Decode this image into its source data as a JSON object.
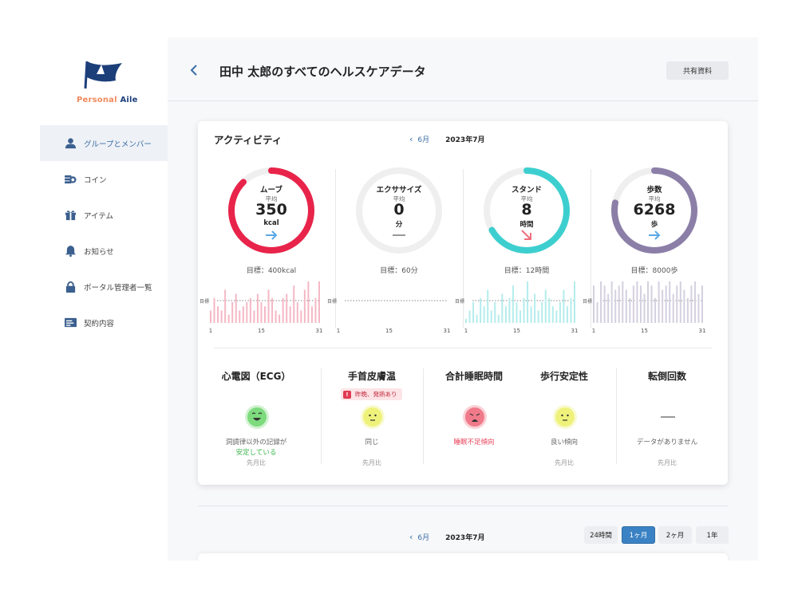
{
  "app": {
    "logo_text_part1": "Personal",
    "logo_text_part2": "Aile"
  },
  "sidebar": {
    "items": [
      {
        "label": "グループとメンバー",
        "icon": "person-icon",
        "active": true
      },
      {
        "label": "コイン",
        "icon": "coin-icon",
        "active": false
      },
      {
        "label": "アイテム",
        "icon": "gift-icon",
        "active": false
      },
      {
        "label": "お知らせ",
        "icon": "bell-icon",
        "active": false
      },
      {
        "label": "ポータル管理者一覧",
        "icon": "lock-icon",
        "active": false
      },
      {
        "label": "契約内容",
        "icon": "contract-icon",
        "active": false
      }
    ]
  },
  "header": {
    "title": "田中 太郎のすべてのヘルスケアデータ",
    "share_label": "共有資料"
  },
  "activity": {
    "title": "アクティビティ",
    "prev_month": "6月",
    "current_month": "2023年7月",
    "metrics": [
      {
        "name": "ムーブ",
        "avg_label": "平均",
        "value": "350",
        "unit": "kcal",
        "goal": "目標：400kcal",
        "trend": "flat",
        "progress": 0.875,
        "color": "#e8244a",
        "bar_color": "#f5b8c4",
        "chart_goal_label": "目標",
        "axis": [
          "1",
          "15",
          "31"
        ],
        "bars": [
          0.3,
          0.6,
          0.4,
          0.3,
          0.8,
          0.2,
          0.5,
          0.7,
          0.3,
          0.4,
          0.5,
          0.6,
          0.3,
          0.7,
          0.5,
          0.4,
          0.8,
          0.6,
          0.3,
          0.2,
          0.6,
          0.7,
          0.4,
          0.9,
          0.5,
          0.3,
          0.8,
          1.0,
          0.4,
          0.6,
          1.0
        ]
      },
      {
        "name": "エクササイズ",
        "avg_label": "平均",
        "value": "0",
        "unit": "分",
        "goal": "目標：60分",
        "trend": "none",
        "progress": 0,
        "color": "#f0f0f0",
        "bar_color": "#e0e0e0",
        "chart_goal_label": "目標",
        "axis": [
          "1",
          "15",
          "31"
        ],
        "bars": []
      },
      {
        "name": "スタンド",
        "avg_label": "平均",
        "value": "8",
        "unit": "時間",
        "goal": "目標：12時間",
        "trend": "down",
        "progress": 0.667,
        "color": "#3dcfcf",
        "bar_color": "#b5ecec",
        "chart_goal_label": "目標",
        "axis": [
          "1",
          "15",
          "31"
        ],
        "bars": [
          0.1,
          0.3,
          0.5,
          0.2,
          0.6,
          0.4,
          0.8,
          0.3,
          0.5,
          0.2,
          0.7,
          0.4,
          0.6,
          0.9,
          0.5,
          0.3,
          0.6,
          1.0,
          0.4,
          0.7,
          0.3,
          0.5,
          0.8,
          0.6,
          0.4,
          0.3,
          0.5,
          0.8,
          0.4,
          0.6,
          1.0
        ]
      },
      {
        "name": "歩数",
        "avg_label": "平均",
        "value": "6268",
        "unit": "歩",
        "goal": "目標：8000歩",
        "trend": "flat",
        "progress": 0.78,
        "color": "#8b7fa8",
        "bar_color": "#d4d0e0",
        "chart_goal_label": "目標",
        "axis": [
          "1",
          "15",
          "31"
        ],
        "bars": [
          0.9,
          0.5,
          1.0,
          0.9,
          0.7,
          1.0,
          0.8,
          0.9,
          1.0,
          0.8,
          0.6,
          0.9,
          1.0,
          0.9,
          0.7,
          1.0,
          0.9,
          0.6,
          1.0,
          0.8,
          0.9,
          1.0,
          0.7,
          0.9,
          1.0,
          0.8,
          0.6,
          0.9,
          1.0,
          0.7,
          0.9
        ]
      }
    ]
  },
  "health": [
    {
      "title": "心電図（ECG）",
      "face": "happy",
      "face_color": "#7ddb7d",
      "status_line1": "洞調律以外の記録が",
      "status_line2": "安定している",
      "status_color": "#3bb54a",
      "compare": "先月比"
    },
    {
      "title": "手首皮膚温",
      "face": "neutral",
      "face_color": "#eef27a",
      "badge": "昨晩、発熱あり",
      "status_line1": "同じ",
      "status_line2": "",
      "status_color": "#666666",
      "compare": "先月比"
    },
    {
      "title": "合計睡眠時間",
      "face": "sad",
      "face_color": "#f07a8a",
      "status_line1": "睡眠不足傾向",
      "status_line2": "",
      "status_color": "#e8435a",
      "compare": ""
    },
    {
      "title": "歩行安定性",
      "face": "neutral",
      "face_color": "#eef27a",
      "status_line1": "良い傾向",
      "status_line2": "",
      "status_color": "#666666",
      "compare": "先月比"
    },
    {
      "title": "転倒回数",
      "face": "none",
      "face_color": "",
      "status_line1": "データがありません",
      "status_line2": "",
      "status_color": "#666666",
      "compare": "先月比"
    }
  ],
  "bottom": {
    "prev_month": "6月",
    "current_month": "2023年7月",
    "ranges": [
      "24時間",
      "1ヶ月",
      "2ヶ月",
      "1年"
    ],
    "active_range": "1ヶ月"
  }
}
